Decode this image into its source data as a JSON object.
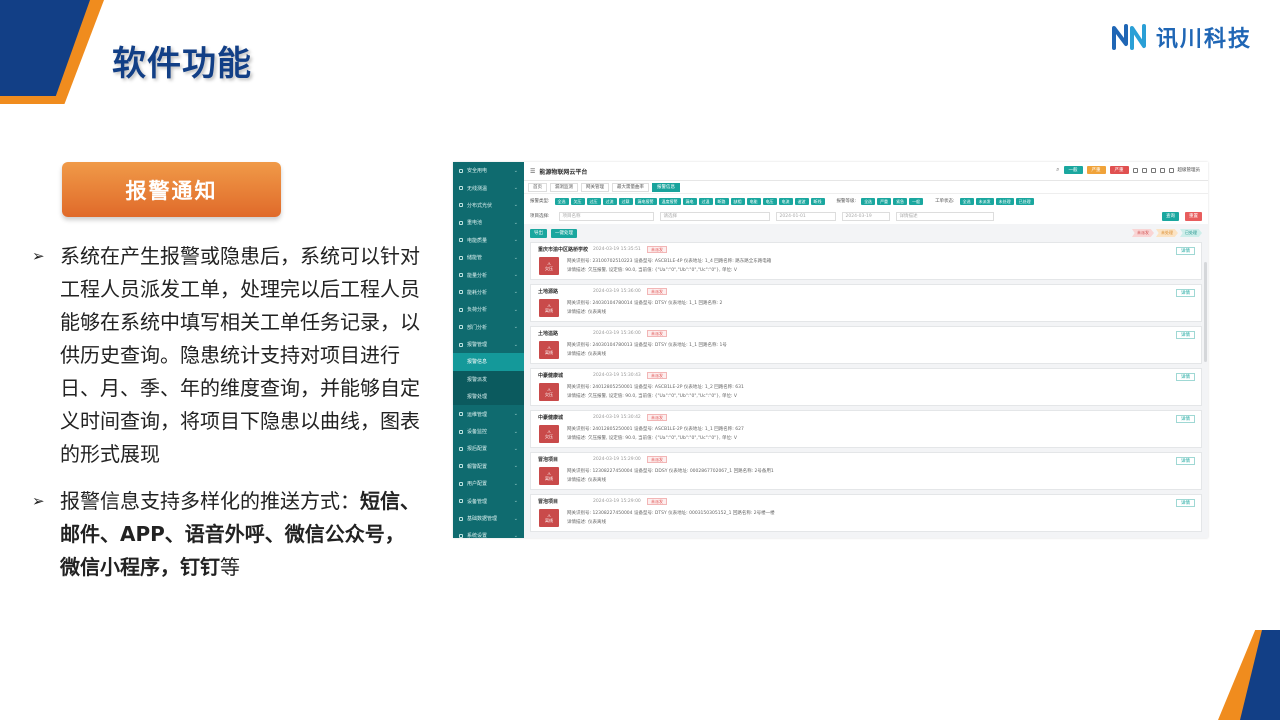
{
  "slide": {
    "title": "软件功能",
    "section_tag": "报警通知",
    "logo_text": "讯川科技",
    "bullet1": "系统在产生报警或隐患后，系统可以针对工程人员派发工单，处理完以后工程人员能够在系统中填写相关工单任务记录，以供历史查询。隐患统计支持对项目进行日、月、季、年的维度查询，并能够自定义时间查询，将项目下隐患以曲线，图表的形式展现",
    "bullet2_prefix": "报警信息支持多样化的推送方式：",
    "bullet2_bold": "短信、邮件、APP、语音外呼、微信公众号，微信小程序，钉钉",
    "bullet2_suffix": "等",
    "bullet_marker": "➢",
    "colors": {
      "brand_blue": "#123f86",
      "brand_orange": "#f08c1e",
      "app_teal": "#1aa79f"
    }
  },
  "app": {
    "title": "能源物联网云平台",
    "header_badges": [
      {
        "label": "一般",
        "color": "#1aa79f"
      },
      {
        "label": "严重",
        "color": "#f0a33a"
      },
      {
        "label": "严重",
        "color": "#e05050"
      }
    ],
    "user": "超级管理员",
    "sidebar": [
      {
        "label": "安全用电",
        "type": "item"
      },
      {
        "label": "无线测温",
        "type": "item"
      },
      {
        "label": "分布式光伏",
        "type": "item"
      },
      {
        "label": "重电池",
        "type": "item"
      },
      {
        "label": "电能质量",
        "type": "item"
      },
      {
        "label": "储能管",
        "type": "item"
      },
      {
        "label": "能量分析",
        "type": "item"
      },
      {
        "label": "能耗分析",
        "type": "item"
      },
      {
        "label": "负荷分析",
        "type": "item"
      },
      {
        "label": "部门分析",
        "type": "item"
      },
      {
        "label": "报警管理",
        "type": "item"
      },
      {
        "label": "报警信息",
        "type": "active"
      },
      {
        "label": "报警派发",
        "type": "sub"
      },
      {
        "label": "报警处理",
        "type": "sub"
      },
      {
        "label": "运维管理",
        "type": "item"
      },
      {
        "label": "设备监控",
        "type": "item"
      },
      {
        "label": "报后配置",
        "type": "item"
      },
      {
        "label": "報警配置",
        "type": "item"
      },
      {
        "label": "用户配置",
        "type": "item"
      },
      {
        "label": "设备管理",
        "type": "item"
      },
      {
        "label": "基础数据管理",
        "type": "item"
      },
      {
        "label": "系统设置",
        "type": "item"
      }
    ],
    "tabs": [
      "首页",
      "漏洞监测",
      "网关管理",
      "最大需量曲率",
      "报警信息"
    ],
    "filter_label": "报警类型:",
    "filter_chips": [
      "全选",
      "欠压",
      "过压",
      "过流",
      "过载",
      "漏电报警",
      "温度报警",
      "漏电",
      "过温",
      "断路",
      "缺相",
      "电能",
      "电压",
      "电流",
      "谐波",
      "断线"
    ],
    "level_label": "报警等级:",
    "level_chips": [
      "全选",
      "严重",
      "紧急",
      "一般"
    ],
    "state_label": "工单状态:",
    "state_chips": [
      "全选",
      "未派发",
      "未处理",
      "已处理"
    ],
    "search": {
      "label": "项目选择:",
      "project_placeholder": "项目名称",
      "device_placeholder": "请选择",
      "date_from": "2024-01-01",
      "date_to": "2024-03-19",
      "keyword_placeholder": "详情描述",
      "query": "查询",
      "reset": "重置"
    },
    "toolbar": {
      "export": "导出",
      "batch": "一键处理"
    },
    "steps": [
      {
        "label": "未派发",
        "bg": "#f9d4d4",
        "fg": "#d04a4a"
      },
      {
        "label": "未处理",
        "bg": "#fbe3c4",
        "fg": "#d98a2a"
      },
      {
        "label": "已处理",
        "bg": "#cdeeea",
        "fg": "#1a8f88"
      }
    ],
    "cards": [
      {
        "title": "重庆市渝中区路桥学校",
        "time": "2024-03-19 15:35:51",
        "tag": "未派发",
        "icon": "欠压",
        "line1": "网关识别号: 23100702510223    设备型号: ASCB1LE-4P    仪表地址: 1_4    回路名称: 路东路全东路电箱",
        "line2": "详情描述: 欠压报警, 设定值: 90.0, 当前值: {\"Ua\":\"0\",\"Ub\":\"0\",\"Uc\":\"0\"}, 单位: V"
      },
      {
        "title": "土地源路",
        "time": "2024-03-19 15:36:00",
        "tag": "未派发",
        "icon": "离线",
        "line1": "网关识别号: 24030104780014    设备型号: DTSY    仪表地址: 1_1    回路名称: 2",
        "line2": "详情描述: 仪表离线"
      },
      {
        "title": "土地溢路",
        "time": "2024-03-19 15:36:00",
        "tag": "未派发",
        "icon": "离线",
        "line1": "网关识别号: 24030104780013    设备型号: DTSY    仪表地址: 1_1    回路名称: 1号",
        "line2": "详情描述: 仪表离线"
      },
      {
        "title": "中豪健康城",
        "time": "2024-03-19 15:30:43",
        "tag": "未派发",
        "icon": "欠压",
        "line1": "网关识别号: 24012805250001    设备型号: ASCB1LE-2P    仪表地址: 1_2    回路名称: 631",
        "line2": "详情描述: 欠压报警, 设定值: 90.0, 当前值: {\"Ua\":\"0\",\"Ub\":\"0\",\"Uc\":\"0\"}, 单位: V"
      },
      {
        "title": "中豪健康城",
        "time": "2024-03-19 15:30:42",
        "tag": "未派发",
        "icon": "欠压",
        "line1": "网关识别号: 24012805250001    设备型号: ASCB1LE-2P    仪表地址: 1_1    回路名称: 627",
        "line2": "详情描述: 欠压报警, 设定值: 90.0, 当前值: {\"Ua\":\"0\",\"Ub\":\"0\",\"Uc\":\"0\"}, 单位: V"
      },
      {
        "title": "冒泡项目",
        "time": "2024-03-19 15:29:00",
        "tag": "未派发",
        "icon": "离线",
        "line1": "网关识别号: 12308227450004    设备型号: DDSY    仪表地址: 0002867702067_1    回路名称: 2号备用1",
        "line2": "详情描述: 仪表离线"
      },
      {
        "title": "冒泡项目",
        "time": "2024-03-19 15:29:00",
        "tag": "未派发",
        "icon": "离线",
        "line1": "网关识别号: 12308227450004    设备型号: DTSY    仪表地址: 0003150305152_1    回路名称: 2号楼一楼",
        "line2": "详情描述: 仪表离线"
      }
    ],
    "detail_label": "详情"
  }
}
